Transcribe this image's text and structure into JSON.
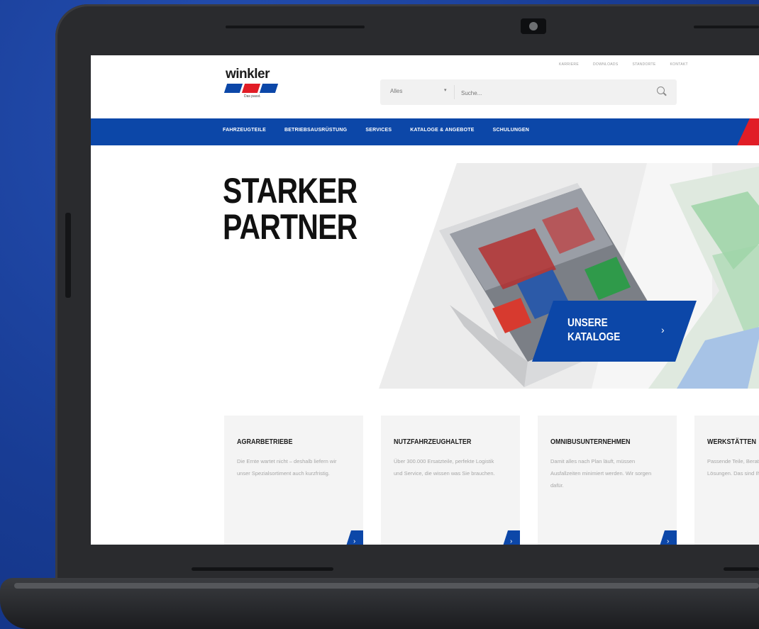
{
  "brand": {
    "name": "winkler",
    "tagline": "Das passt.",
    "bar_colors": [
      "#0c47a8",
      "#e11d26",
      "#0c47a8"
    ]
  },
  "topnav": {
    "items": [
      "KARRIERE",
      "DOWNLOADS",
      "STANDORTE",
      "KONTAKT"
    ]
  },
  "search": {
    "category": "Alles",
    "placeholder": "Suche..."
  },
  "mainnav": {
    "items": [
      "FAHRZEUGTEILE",
      "BETRIEBSAUSRÜSTUNG",
      "SERVICES",
      "KATALOGE & ANGEBOTE",
      "SCHULUNGEN"
    ]
  },
  "hero": {
    "title_line1": "STARKER",
    "title_line2": "PARTNER",
    "cta_line1": "UNSERE",
    "cta_line2": "KATALOGE"
  },
  "cards": [
    {
      "title": "AGRARBETRIEBE",
      "text": "Die Ernte wartet nicht – deshalb liefern wir unser Spezialsortiment auch kurzfristig."
    },
    {
      "title": "NUTZFAHRZEUGHALTER",
      "text": "Über 300.000 Ersatzteile, perfekte Logistik und Service, die wissen was Sie brauchen."
    },
    {
      "title": "OMNIBUSUNTERNEHMEN",
      "text": "Damit alles nach Plan läuft, müssen Ausfallzeiten minimiert werden. Wir sorgen dafür."
    },
    {
      "title": "WERKSTÄTTEN",
      "text": "Passende Teile, Beratung, handfeste Lösungen. Das sind Ihre Stärken."
    }
  ],
  "colors": {
    "primary": "#0c47a8",
    "accent": "#e11d26",
    "laptop_background": "#1a3f9a"
  }
}
